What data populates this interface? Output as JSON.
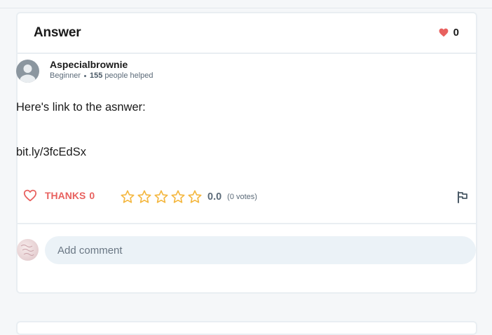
{
  "header": {
    "title": "Answer",
    "like_count": "0"
  },
  "author": {
    "name": "Aspecialbrownie",
    "rank": "Beginner",
    "helped_count": "155",
    "helped_label": "people helped"
  },
  "answer": {
    "line1": "Here's link to the asnwer:",
    "line2": "bit.ly/3fcEdSx"
  },
  "actions": {
    "thanks_label": "THANKS",
    "thanks_count": "0",
    "rating_value": "0.0",
    "rating_votes": "(0 votes)",
    "stars_filled": 0,
    "stars_total": 5
  },
  "comment": {
    "placeholder": "Add comment"
  },
  "colors": {
    "accent_red": "#e8615f",
    "star_yellow": "#f4b73f",
    "muted_text": "#5b6a78",
    "input_bg": "#ebf2f7"
  }
}
